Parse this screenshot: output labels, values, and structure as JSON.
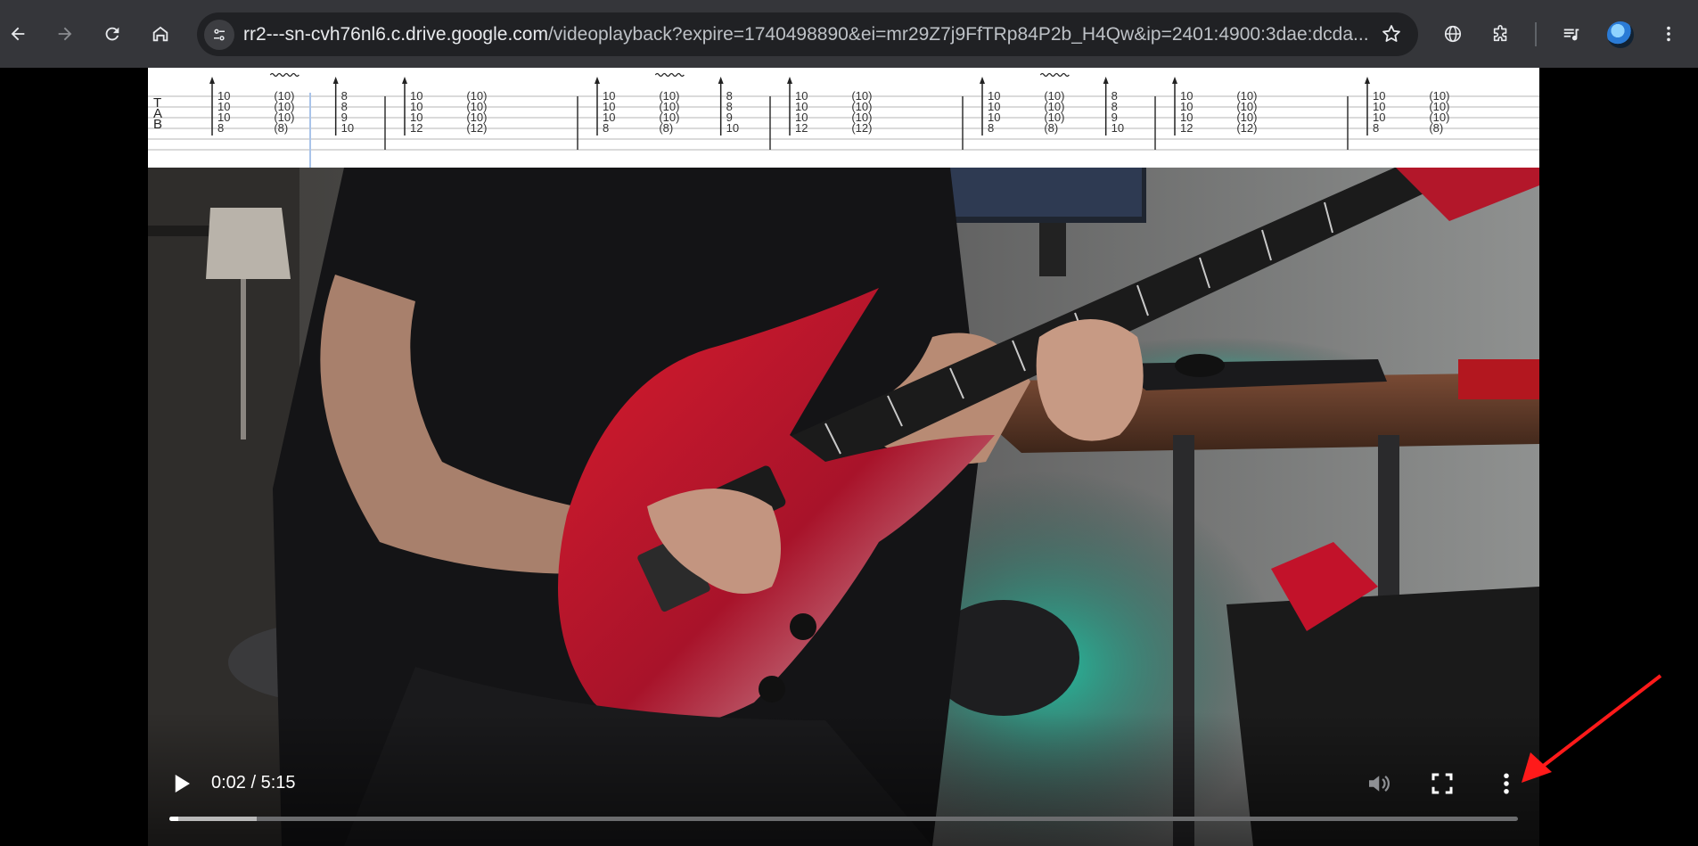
{
  "browser": {
    "url_host": "rr2---sn-cvh76nl6.c.drive.google.com",
    "url_rest": "/videoplayback?expire=1740498890&ei=mr29Z7j9FfTRp84P2b_H4Qw&ip=2401:4900:3dae:dcda...",
    "icons": {
      "back": "arrow-left-icon",
      "forward": "arrow-right-icon",
      "reload": "reload-icon",
      "home": "home-icon",
      "site_info": "tune-icon",
      "bookmark": "star-icon",
      "translate": "globe-icon",
      "extensions": "puzzle-icon",
      "media": "media-control-icon",
      "profile": "avatar",
      "menu": "kebab-menu-icon"
    }
  },
  "tablature": {
    "string_labels": [
      "T",
      "A",
      "B"
    ],
    "vibrato_marks": 3,
    "measures": [
      [
        {
          "frets": [
            "10",
            "10",
            "10",
            "8"
          ],
          "bend": true
        },
        {
          "frets": [
            "(10)",
            "(10)",
            "(10)",
            "(8)"
          ],
          "vibrato": true
        },
        {
          "frets": [
            "8",
            "8",
            "9",
            "10"
          ],
          "bend": true
        }
      ],
      [
        {
          "frets": [
            "10",
            "10",
            "10",
            "12"
          ],
          "bend": true
        },
        {
          "frets": [
            "(10)",
            "(10)",
            "(10)",
            "(12)"
          ]
        }
      ],
      [
        {
          "frets": [
            "10",
            "10",
            "10",
            "8"
          ],
          "bend": true
        },
        {
          "frets": [
            "(10)",
            "(10)",
            "(10)",
            "(8)"
          ],
          "vibrato": true
        },
        {
          "frets": [
            "8",
            "8",
            "9",
            "10"
          ],
          "bend": true
        }
      ],
      [
        {
          "frets": [
            "10",
            "10",
            "10",
            "12"
          ],
          "bend": true
        },
        {
          "frets": [
            "(10)",
            "(10)",
            "(10)",
            "(12)"
          ]
        }
      ],
      [
        {
          "frets": [
            "10",
            "10",
            "10",
            "8"
          ],
          "bend": true
        },
        {
          "frets": [
            "(10)",
            "(10)",
            "(10)",
            "(8)"
          ],
          "vibrato": true
        },
        {
          "frets": [
            "8",
            "8",
            "9",
            "10"
          ],
          "bend": true
        }
      ],
      [
        {
          "frets": [
            "10",
            "10",
            "10",
            "12"
          ],
          "bend": true
        },
        {
          "frets": [
            "(10)",
            "(10)",
            "(10)",
            "(12)"
          ]
        }
      ],
      [
        {
          "frets": [
            "10",
            "10",
            "10",
            "8"
          ],
          "bend": true
        },
        {
          "frets": [
            "(10)",
            "(10)",
            "(10)",
            "(8)"
          ]
        }
      ]
    ]
  },
  "player": {
    "time_display": "0:02 / 5:15",
    "current_time": "0:02",
    "duration": "5:15",
    "progress_played": 0.0065,
    "progress_buffered": 0.065,
    "controls": {
      "play": "play-icon",
      "mute": "volume-icon",
      "fullscreen": "fullscreen-icon",
      "more": "more-vert-icon"
    }
  },
  "annotation": {
    "arrow_color": "#ff1a1a",
    "points_to": "more-options-button"
  },
  "colors": {
    "toolbar_bg": "#35363a",
    "omnibox_bg": "#202124",
    "guitar_red": "#c0182a"
  }
}
